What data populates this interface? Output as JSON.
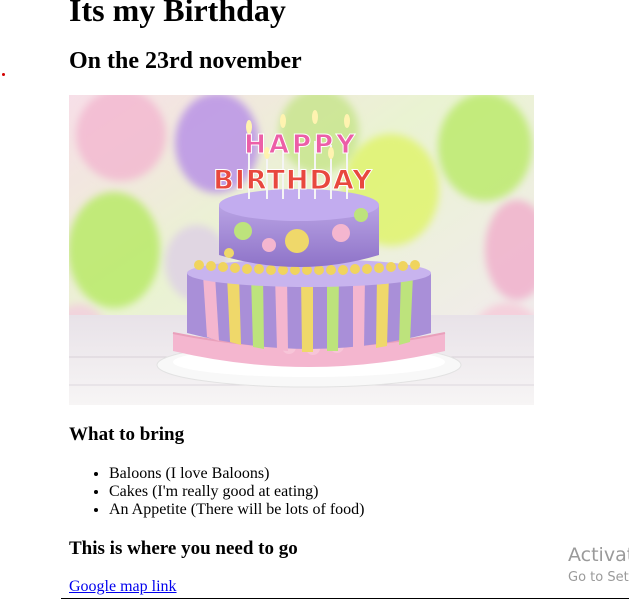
{
  "page": {
    "title": "Its my Birthday",
    "subtitle": "On the 23rd november"
  },
  "photo": {
    "cake_topper_line1": "HAPPY",
    "cake_topper_line2": "BIRTHDAY"
  },
  "bring": {
    "heading": "What to bring",
    "items": [
      "Baloons (I love Baloons)",
      "Cakes (I'm really good at eating)",
      "An Appetite (There will be lots of food)"
    ]
  },
  "location": {
    "heading": "This is where you need to go",
    "link_label": "Google map link"
  },
  "watermark": {
    "title": "Activat",
    "subtitle": "Go to Set"
  },
  "colors": {
    "link": "#0000ee",
    "text": "#000000",
    "watermark": "#9a9a9a",
    "cake_purple": "#a98fd8",
    "cake_pink": "#f4b6cf",
    "cake_yellow": "#efd86a",
    "cake_green": "#bde37c"
  }
}
